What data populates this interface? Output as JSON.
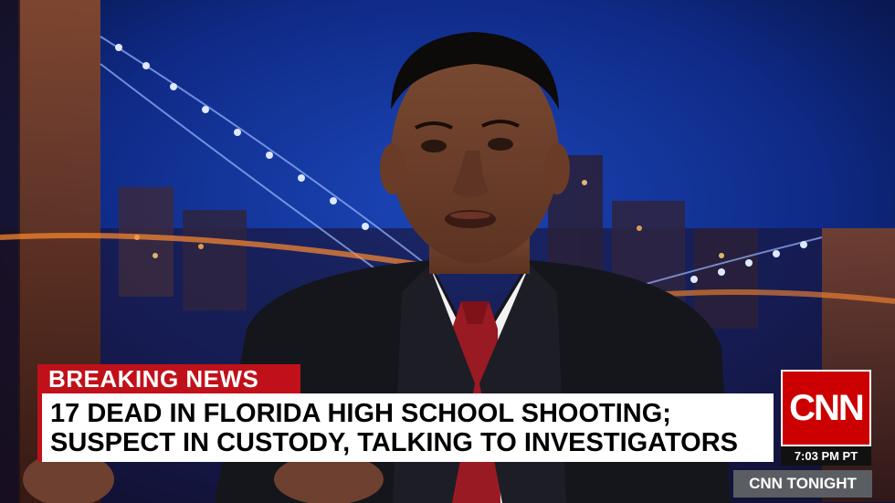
{
  "banner": {
    "label": "BREAKING NEWS",
    "headline_line1": "17 DEAD IN FLORIDA HIGH SCHOOL SHOOTING;",
    "headline_line2": "SUSPECT IN CUSTODY, TALKING TO INVESTIGATORS"
  },
  "network": {
    "logo_text": "CNN",
    "time": "7:03 PM PT",
    "show": "CNN TONIGHT"
  },
  "colors": {
    "breaking_red": "#c0111a",
    "logo_red": "#cc0000",
    "background_blue": "#0a1840"
  }
}
